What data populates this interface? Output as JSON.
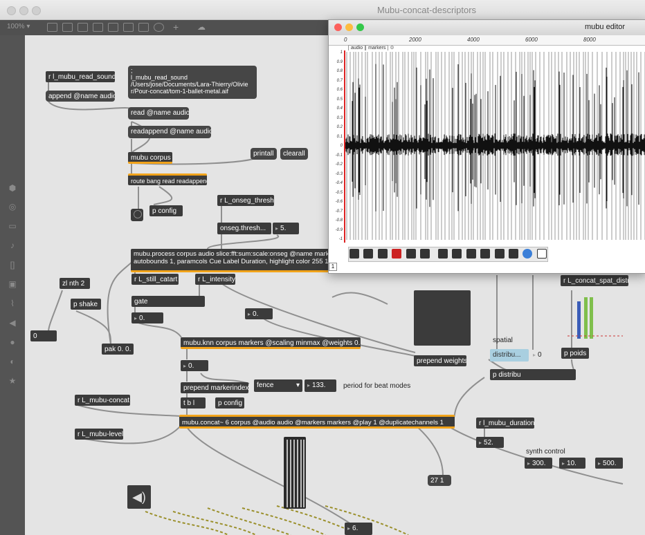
{
  "window": {
    "title": "Mubu-concat-descriptors",
    "zoom": "100% ▾"
  },
  "patch": {
    "objects": {
      "r_read_sound": "r l_mubu_read_sound",
      "append": "append @name audio",
      "read_sound_msg_1": ";",
      "read_sound_msg_2": "l_mubu_read_sound",
      "read_sound_msg_3": "/Users/jose/Documents/Lara-Thierry/Olivie",
      "read_sound_msg_4": "r/Pour-concat/tom-1-ballet-metal.aif",
      "read_msg": "read @name audio",
      "readappend_msg": "readappend @name audio",
      "mubu_corpus": "mubu corpus",
      "printall": "printall",
      "clearall": "clearall",
      "route": "route bang read readappend",
      "p_config_1": "p config",
      "r_onseg": "r L_onseg_thresh",
      "onseg_thresh": "onseg.thresh...",
      "onseg_val": "5.",
      "mubu_process_1": "mubu.process corpus audio slice:fft:sum:scale:onseg @name marke",
      "mubu_process_2": "autobounds 1, paramcols Cue Label Duration, highlight color 255 1",
      "zl_nth": "zl nth 2",
      "r_still": "r L_still_catart",
      "r_intensity": "r L_intensity",
      "p_shake": "p shake",
      "gate": "gate",
      "gate_val": "0.",
      "intensity_val": "0.",
      "zero": "0",
      "pak": "pak 0. 0.",
      "knn": "mubu.knn corpus markers @scaling minmax @weights 0. 1.",
      "knn_val": "0.",
      "prepend_weights": "prepend weights",
      "prepend_markerindex": "prepend markerindex",
      "fence": "fence",
      "num_133": "133.",
      "tbl": "t b l",
      "p_config_2": "p config",
      "r_concat": "r L_mubu-concat",
      "concat": "mubu.concat~ 6 corpus @audio audio @markers markers @play 1 @duplicatechannels 1",
      "r_level": "r L_mubu-level",
      "distribu": "distribu...",
      "distribu_val": "0",
      "p_distribu": "p distribu",
      "p_poids": "p poids",
      "r_spat": "r L_concat_spat_distr",
      "r_duration": "r l_mubu_duration",
      "num_52": "52.",
      "num_300": "300.",
      "num_10": "10.",
      "num_500": "500.",
      "msg_27": "27 1",
      "num_6": "6."
    },
    "labels": {
      "period": "period for beat modes",
      "spatial": "spatial",
      "synth_control": "synth control"
    }
  },
  "editor": {
    "title": "mubu editor",
    "ruler": [
      "0",
      "2000",
      "4000",
      "6000",
      "8000"
    ],
    "tabs": [
      "audio",
      "markers"
    ],
    "y_ticks": [
      "1",
      "0.9",
      "0.8",
      "0.7",
      "0.6",
      "0.5",
      "0.4",
      "0.3",
      "0.2",
      "0.1",
      "0",
      "-0.1",
      "-0.2",
      "-0.3",
      "-0.4",
      "-0.5",
      "-0.6",
      "-0.7",
      "-0.8",
      "-0.9",
      "-1"
    ],
    "page": "1"
  },
  "colors": {
    "accent": "#f1a31a",
    "object_bg": "#3b3b3b",
    "canvas_bg": "#e4e4e4",
    "distribu_bg": "#a9cfe0"
  }
}
